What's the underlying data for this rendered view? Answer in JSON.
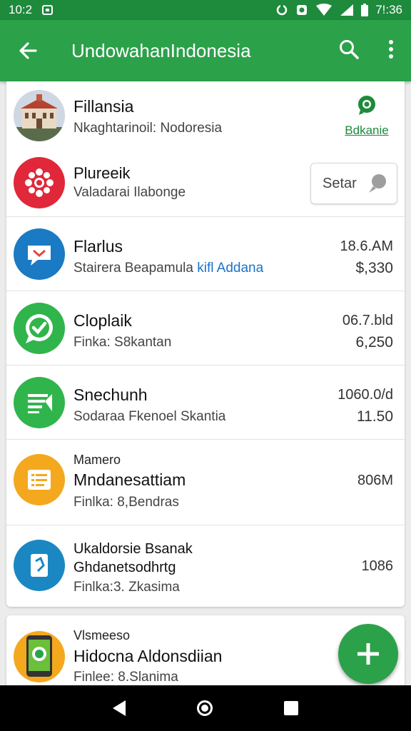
{
  "status_bar": {
    "time_left": "10:2",
    "time_right": "7!:36"
  },
  "app_bar": {
    "title": "UndowahanIndonesia"
  },
  "items": [
    {
      "title": "Fillansia",
      "subtitle": "Nkaghtarinoil: Nodoresia",
      "action_label": "Bdkanie"
    },
    {
      "title": "Plureeik",
      "subtitle": "Valadarai Ilabonge",
      "button_label": "Setar"
    },
    {
      "title": "Flarlus",
      "subtitle": "Stairera Beapamula",
      "subtitle_link": "kifl Addana",
      "meta1": "18.6.AM",
      "meta2": "$,330"
    },
    {
      "title": "Cloplaik",
      "subtitle": "Finka: S8kantan",
      "meta1": "06.7.bld",
      "meta2": "6,250"
    },
    {
      "title": "Snechunh",
      "subtitle": "Sodaraa Fkenoel Skantia",
      "meta1": "1060.0/d",
      "meta2": "11.50"
    },
    {
      "overline": "Mamero",
      "title": "Mndanesattiam",
      "subtitle": "Finlka: 8,Bendras",
      "meta1": "806M"
    },
    {
      "title": "Ukaldorsie Bsanak",
      "title2": "Ghdanetsodhrtg",
      "subtitle": "Finlka:3. Zkasima",
      "meta1": "1086"
    },
    {
      "overline": "Vlsmeeso",
      "title": "Hidocna Aldonsdiian",
      "subtitle": "Finlee: 8.Slanima"
    }
  ],
  "colors": {
    "primary": "#2ba14a",
    "status": "#1e8a3c",
    "link": "#1a73c8"
  }
}
